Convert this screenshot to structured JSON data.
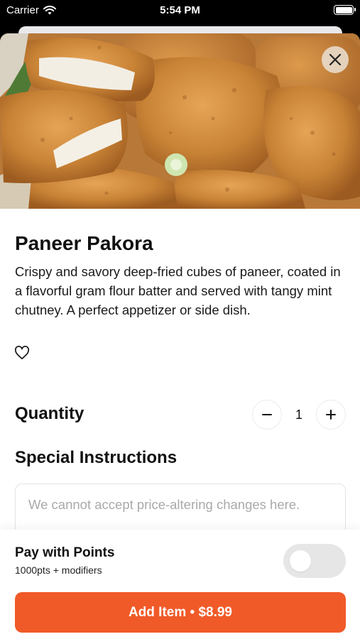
{
  "status_bar": {
    "carrier": "Carrier",
    "time": "5:54 PM"
  },
  "item": {
    "name": "Paneer Pakora",
    "description": "Crispy and savory deep-fried cubes of paneer, coated in a flavorful gram flour batter and served with tangy mint chutney. A perfect appetizer or side dish."
  },
  "quantity": {
    "label": "Quantity",
    "value": "1"
  },
  "special_instructions": {
    "label": "Special Instructions",
    "placeholder": "We cannot accept price-altering changes here."
  },
  "points": {
    "title": "Pay with Points",
    "subtitle": "1000pts + modifiers",
    "enabled": false
  },
  "add_button": {
    "label": "Add Item • $8.99"
  },
  "colors": {
    "accent": "#f05a28",
    "toggle_off": "#e6e6e6"
  },
  "icons": [
    "wifi-icon",
    "battery-icon",
    "close-icon",
    "heart-icon",
    "minus-icon",
    "plus-icon"
  ]
}
